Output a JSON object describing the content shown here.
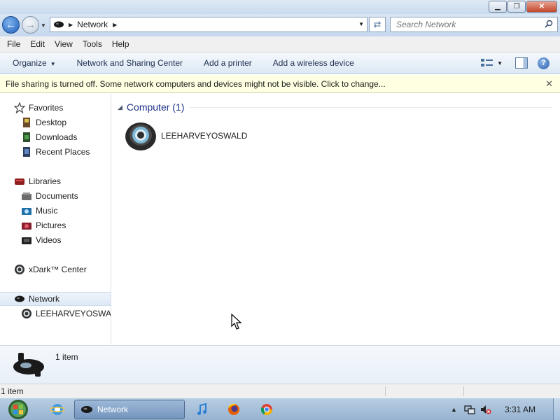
{
  "window": {
    "minimize": "▁",
    "maximize": "❐",
    "close": "✕"
  },
  "address": {
    "location": "Network",
    "search_placeholder": "Search Network"
  },
  "menu": [
    "File",
    "Edit",
    "View",
    "Tools",
    "Help"
  ],
  "commands": {
    "organize": "Organize",
    "sharing_center": "Network and Sharing Center",
    "add_printer": "Add a printer",
    "add_wireless": "Add a wireless device"
  },
  "infobar": {
    "message": "File sharing is turned off. Some network computers and devices might not be visible. Click to change..."
  },
  "nav": {
    "favorites": "Favorites",
    "desktop": "Desktop",
    "downloads": "Downloads",
    "recent": "Recent Places",
    "libraries": "Libraries",
    "documents": "Documents",
    "music": "Music",
    "pictures": "Pictures",
    "videos": "Videos",
    "xdark": "xDark™ Center",
    "network": "Network",
    "computer": "LEEHARVEYOSWALD"
  },
  "content": {
    "group_title": "Computer (1)",
    "computer_name": "LEEHARVEYOSWALD"
  },
  "details": {
    "count": "1 item"
  },
  "status": {
    "count": "1 item"
  },
  "taskbar": {
    "window_label": "Network",
    "clock": "3:31 AM"
  }
}
